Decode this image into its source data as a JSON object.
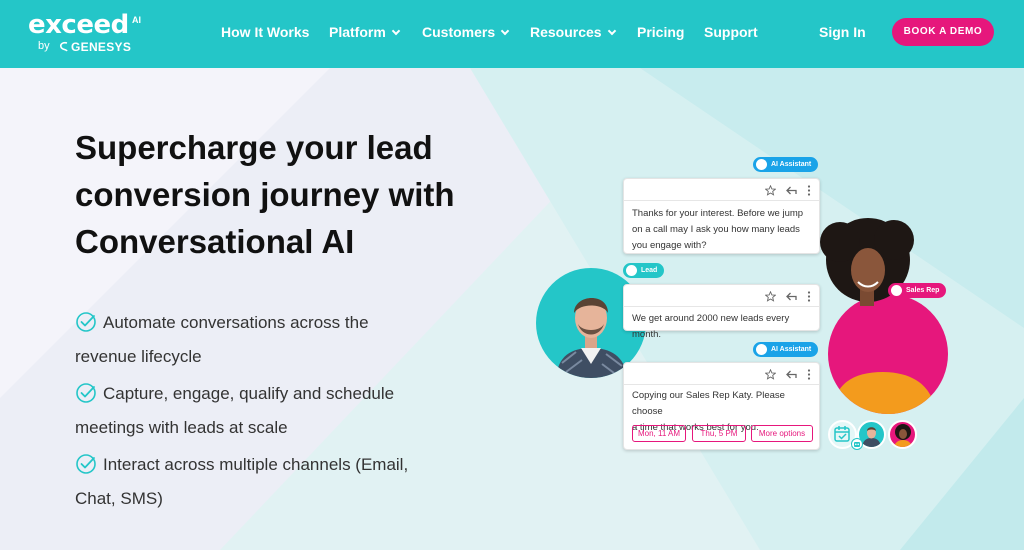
{
  "brand": {
    "wordmark": "exceed",
    "superscript": "AI",
    "by": "by",
    "company": "GENESYS"
  },
  "nav": {
    "items": [
      {
        "label": "How It Works",
        "has_dropdown": false
      },
      {
        "label": "Platform",
        "has_dropdown": true
      },
      {
        "label": "Customers",
        "has_dropdown": true
      },
      {
        "label": "Resources",
        "has_dropdown": true
      },
      {
        "label": "Pricing",
        "has_dropdown": false
      },
      {
        "label": "Support",
        "has_dropdown": false
      }
    ],
    "sign_in": "Sign In",
    "cta": "BOOK A DEMO"
  },
  "hero": {
    "headline": [
      "Supercharge your lead",
      "conversion journey with",
      "Conversational AI"
    ],
    "bullets": [
      [
        "Automate conversations across the",
        "revenue lifecycle"
      ],
      [
        "Capture, engage, qualify and schedule",
        "meetings with leads at scale"
      ],
      [
        "Interact across multiple channels (Email,",
        "Chat, SMS)"
      ]
    ]
  },
  "illustration": {
    "tags": {
      "assistant_1": "AI Assistant",
      "lead": "Lead",
      "sales_rep": "Sales Rep",
      "assistant_2": "AI Assistant"
    },
    "messages": {
      "assistant_1": [
        "Thanks for your interest. Before we jump",
        "on a call may I ask you how many leads",
        "you engage with?"
      ],
      "lead": [
        "We get around 2000 new leads every month."
      ],
      "assistant_2": [
        "Copying our Sales Rep Katy. Please choose",
        "a time that works best for you:"
      ]
    },
    "time_options": [
      "Mon, 11 AM",
      "Thu, 5 PM",
      "More options"
    ],
    "icons": [
      "star-icon",
      "reply-icon",
      "more-vertical-icon",
      "calendar-icon",
      "robot-icon",
      "user-icon"
    ]
  },
  "colors": {
    "nav_bg": "#24c6c8",
    "cta": "#e6177c",
    "teal": "#24c6c8",
    "assistant_tag": "#1aa3e8",
    "lead_tag": "#24c6c8",
    "rep_tag": "#e6177c",
    "check": "#24c6c8"
  }
}
